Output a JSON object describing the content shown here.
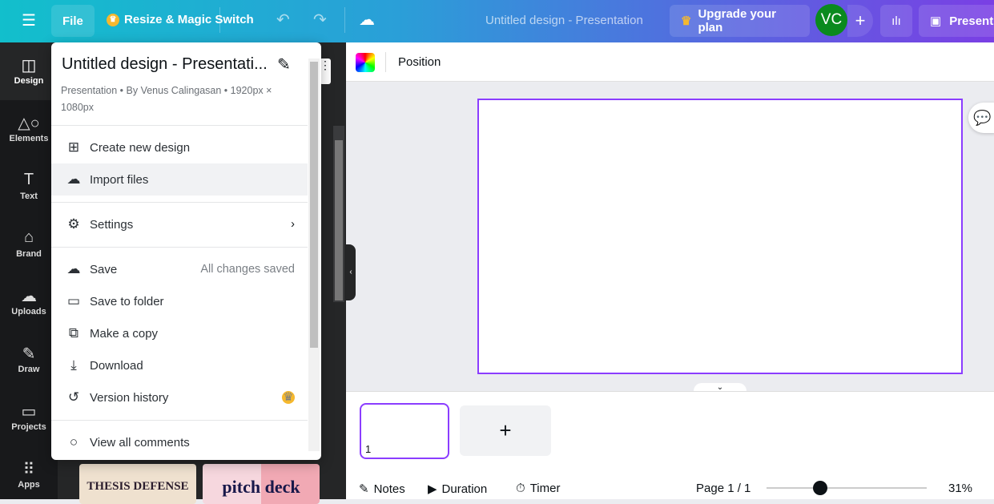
{
  "topbar": {
    "file": "File",
    "resize": "Resize & Magic Switch",
    "doc_title": "Untitled design - Presentation",
    "upgrade": "Upgrade your plan",
    "avatar": "VC",
    "present": "Present"
  },
  "rail": [
    {
      "label": "Design",
      "icon": "layout-icon"
    },
    {
      "label": "Elements",
      "icon": "shapes-icon"
    },
    {
      "label": "Text",
      "icon": "text-icon"
    },
    {
      "label": "Brand",
      "icon": "brand-icon"
    },
    {
      "label": "Uploads",
      "icon": "cloud-upload-icon"
    },
    {
      "label": "Draw",
      "icon": "draw-icon"
    },
    {
      "label": "Projects",
      "icon": "folder-icon"
    },
    {
      "label": "Apps",
      "icon": "apps-icon"
    }
  ],
  "templates": [
    "THESIS DEFENSE",
    "pitch deck"
  ],
  "menu": {
    "title": "Untitled design - Presentati...",
    "subtitle": "Presentation • By Venus Calingasan • 1920px × 1080px",
    "items": [
      {
        "label": "Create new design"
      },
      {
        "label": "Import files"
      },
      {
        "label": "Settings"
      },
      {
        "label": "Save",
        "right": "All changes saved"
      },
      {
        "label": "Save to folder"
      },
      {
        "label": "Make a copy"
      },
      {
        "label": "Download"
      },
      {
        "label": "Version history"
      },
      {
        "label": "View all comments"
      }
    ]
  },
  "context": {
    "position": "Position"
  },
  "pages": {
    "current": "1"
  },
  "bottom": {
    "notes": "Notes",
    "duration": "Duration",
    "timer": "Timer",
    "page": "Page 1 / 1",
    "zoom": "31%",
    "zoom_value": 31
  },
  "colors": {
    "accent": "#8b3dff",
    "crown": "#f5b82e",
    "avatar": "#0a8a1e"
  }
}
